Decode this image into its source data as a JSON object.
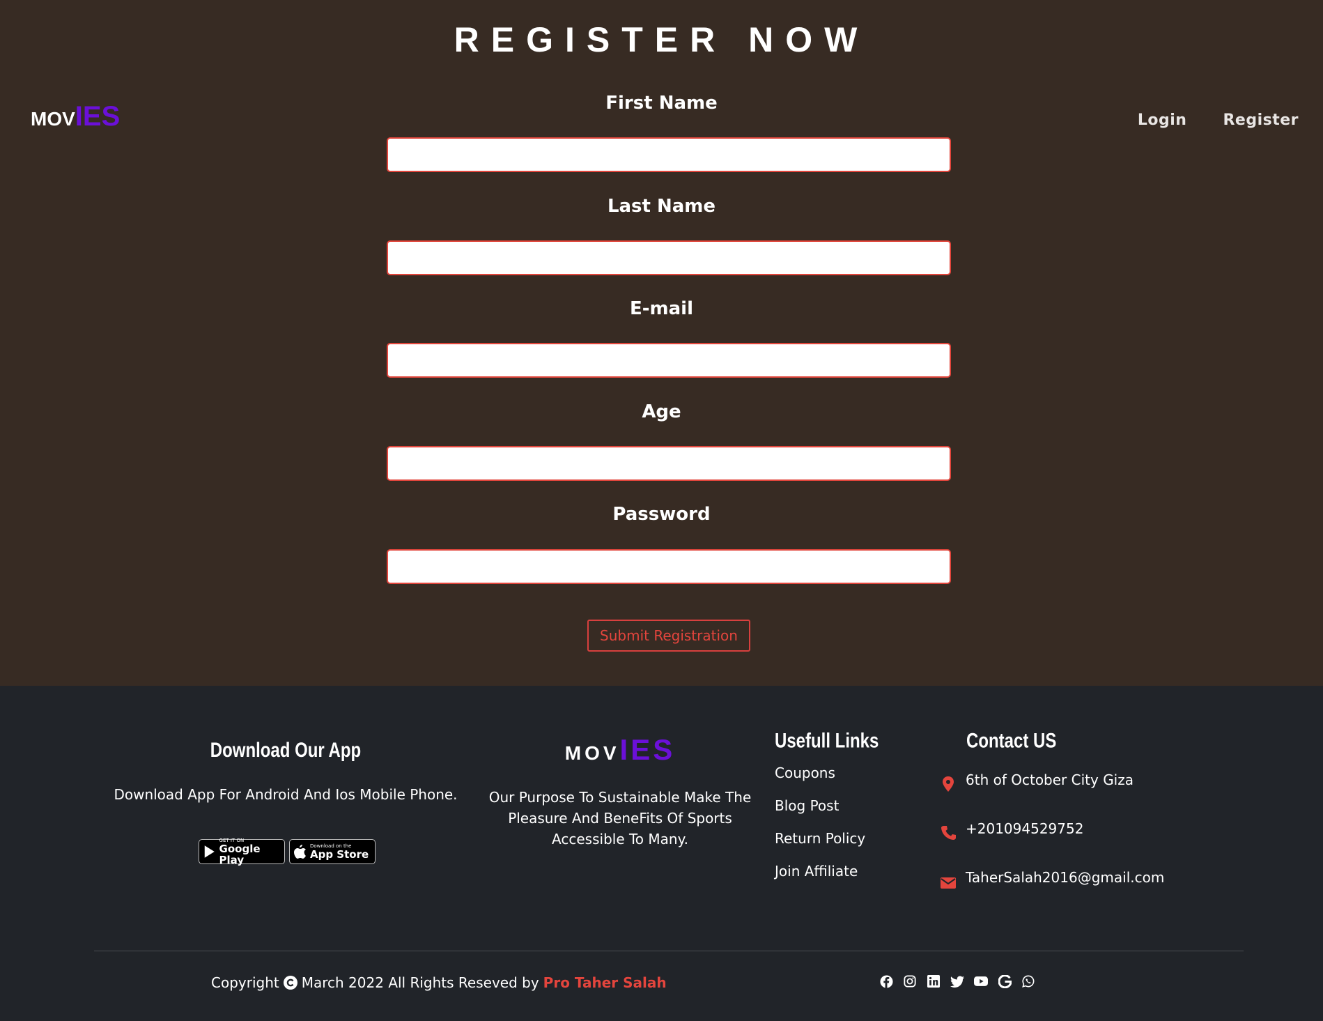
{
  "header": {
    "page_title": "REGISTER NOW",
    "logo": {
      "part1": "MOV",
      "part2": "IES",
      "accent_color": "#6b10d8"
    },
    "nav": [
      {
        "label": "Login"
      },
      {
        "label": "Register"
      }
    ]
  },
  "form": {
    "fields": [
      {
        "label": "First Name",
        "value": ""
      },
      {
        "label": "Last Name",
        "value": ""
      },
      {
        "label": "E-mail",
        "value": ""
      },
      {
        "label": "Age",
        "value": ""
      },
      {
        "label": "Password",
        "value": ""
      }
    ],
    "submit_label": "Submit Registration",
    "accent_color": "#e1453b"
  },
  "footer": {
    "app": {
      "title": "Download Our App",
      "text": "Download App For Android And Ios Mobile Phone.",
      "google_play": {
        "small": "GET IT ON",
        "big": "Google Play"
      },
      "app_store": {
        "small": "Download on the",
        "big": "App Store"
      }
    },
    "about": {
      "logo_part1": "MOV",
      "logo_part2": "IES",
      "text": "Our Purpose To Sustainable Make The Pleasure And BeneFits Of Sports Accessible To Many."
    },
    "links": {
      "title": "Usefull Links",
      "items": [
        "Coupons",
        "Blog Post",
        "Return Policy",
        "Join Affiliate"
      ]
    },
    "contact": {
      "title": "Contact US",
      "address": "6th of October City Giza",
      "phone": "+201094529752",
      "email": "TaherSalah2016@gmail.com"
    },
    "copyright": {
      "prefix": "Copyright",
      "middle": "March 2022 All Rights Reseved by",
      "author": "Pro Taher Salah"
    },
    "socials": [
      "facebook-icon",
      "instagram-icon",
      "linkedin-icon",
      "twitter-icon",
      "youtube-icon",
      "google-icon",
      "whatsapp-icon"
    ]
  }
}
